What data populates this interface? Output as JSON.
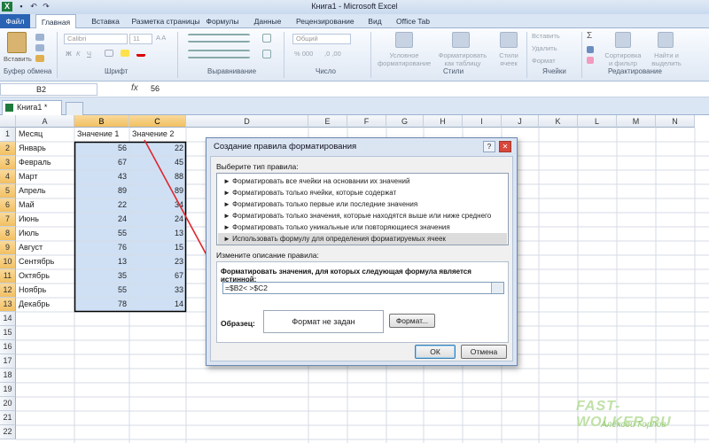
{
  "app": {
    "title": "Книга1 - Microsoft Excel",
    "tabs": [
      "Файл",
      "Главная",
      "Вставка",
      "Разметка страницы",
      "Формулы",
      "Данные",
      "Рецензирование",
      "Вид",
      "Office Tab"
    ]
  },
  "ribbon": {
    "paste_label": "Вставить",
    "font_name": "Calibri",
    "font_size": "11",
    "number_format": "Общий",
    "styles": [
      "Условное форматирование",
      "Форматировать как таблицу",
      "Стили ячеек"
    ],
    "cells_buttons": [
      "Вставить",
      "Удалить",
      "Формат"
    ],
    "editing_buttons": [
      "Сортировка и фильтр",
      "Найти и выделить"
    ],
    "groups": [
      "Буфер обмена",
      "Шрифт",
      "Выравнивание",
      "Число",
      "Стили",
      "Ячейки",
      "Редактирование"
    ]
  },
  "formula_bar": {
    "name_box": "B2",
    "fx": "fx",
    "value": "56"
  },
  "workbook_tab": "Книга1 *",
  "sheet": {
    "columns": [
      "A",
      "B",
      "C",
      "D",
      "E",
      "F",
      "G",
      "H",
      "I",
      "J",
      "K",
      "L",
      "M",
      "N"
    ],
    "rows": [
      "1",
      "2",
      "3",
      "4",
      "5",
      "6",
      "7",
      "8",
      "9",
      "10",
      "11",
      "12",
      "13",
      "14",
      "15",
      "16",
      "17",
      "18",
      "19",
      "20",
      "21",
      "22"
    ],
    "headers": [
      "Месяц",
      "Значение 1",
      "Значение 2"
    ],
    "data": [
      [
        "Январь",
        "56",
        "22"
      ],
      [
        "Февраль",
        "67",
        "45"
      ],
      [
        "Март",
        "43",
        "88"
      ],
      [
        "Апрель",
        "89",
        "89"
      ],
      [
        "Май",
        "22",
        "34"
      ],
      [
        "Июнь",
        "24",
        "24"
      ],
      [
        "Июль",
        "55",
        "13"
      ],
      [
        "Август",
        "76",
        "15"
      ],
      [
        "Сентябрь",
        "13",
        "23"
      ],
      [
        "Октябрь",
        "35",
        "67"
      ],
      [
        "Ноябрь",
        "55",
        "33"
      ],
      [
        "Декабрь",
        "78",
        "14"
      ]
    ]
  },
  "dialog": {
    "title": "Создание правила форматирования",
    "help": "?",
    "close": "✕",
    "select_label": "Выберите тип правила:",
    "rule_types": [
      "► Форматировать все ячейки на основании их значений",
      "► Форматировать только ячейки, которые содержат",
      "► Форматировать только первые или последние значения",
      "► Форматировать только значения, которые находятся выше или ниже среднего",
      "► Форматировать только уникальные или повторяющиеся значения",
      "► Использовать формулу для определения форматируемых ячеек"
    ],
    "selected_rule_index": 5,
    "desc_label": "Измените описание правила:",
    "formula_label": "Форматировать значения, для которых следующая формула является истинной:",
    "formula": "=$B2< >$C2",
    "sample_label": "Образец:",
    "preview_text": "Формат не задан",
    "format_button": "Формат...",
    "ok": "ОК",
    "cancel": "Отмена"
  },
  "watermark": {
    "site": "FAST-WOLKER.RU",
    "author": "Алексей Горлов"
  },
  "colors": {
    "accent": "#2a62b4",
    "selection": "#cfe0f5",
    "header_selected": "#f2c062",
    "annotation": "#e0262b"
  }
}
